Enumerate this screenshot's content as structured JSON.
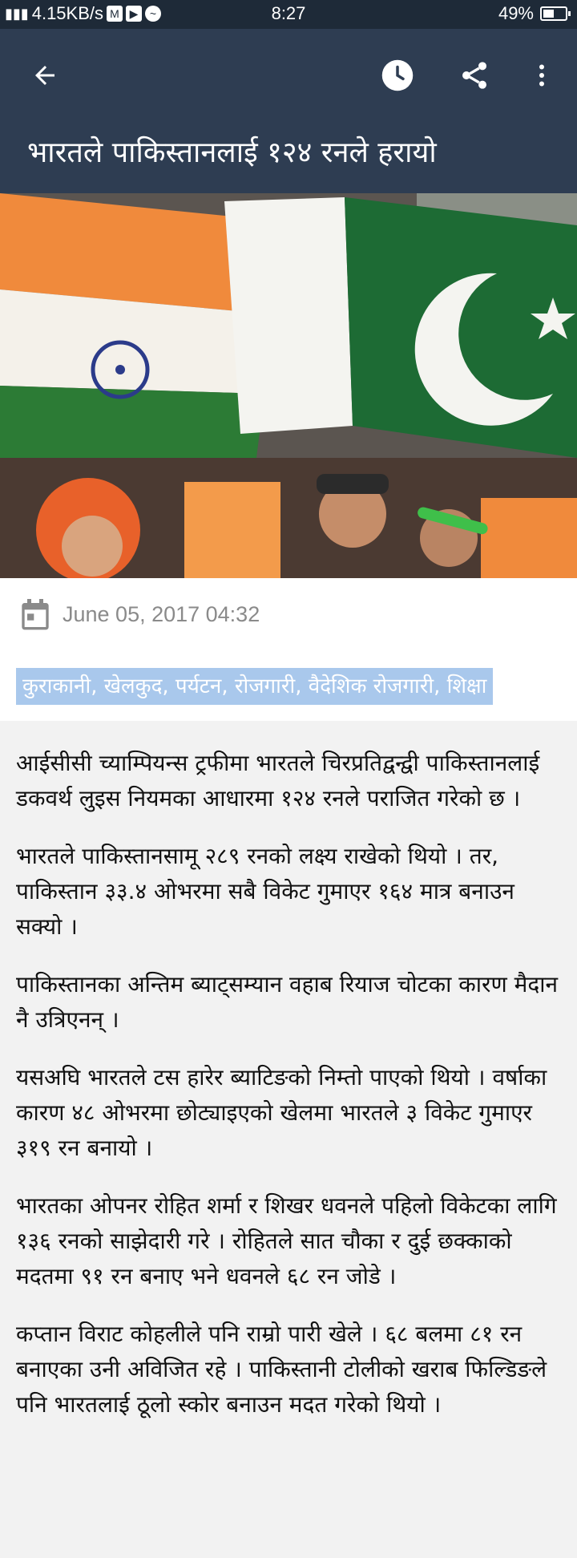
{
  "status_bar": {
    "network_speed": "4.15KB/s",
    "time": "8:27",
    "battery_level": "49%",
    "battery_fraction": 0.49
  },
  "app_bar": {
    "title": "भारतले पाकिस्तानलाई १२४ रनले हरायो"
  },
  "article_meta": {
    "date": "June 05, 2017 04:32",
    "tags": "कुराकानी, खेलकुद, पर्यटन, रोजगारी, वैदेशिक रोजगारी, शिक्षा"
  },
  "article_body": {
    "paragraphs": [
      "आईसीसी च्याम्पियन्स ट्रफीमा भारतले चिरप्रतिद्वन्द्वी पाकिस्तानलाई डकवर्थ लुइस नियमका आधारमा १२४ रनले पराजित गरेको छ ।",
      "भारतले पाकिस्तानसामू २८९ रनको लक्ष्य राखेको थियो । तर, पाकिस्तान ३३.४ ओभरमा सबै विकेट गुमाएर १६४ मात्र बनाउन सक्यो ।",
      "पाकिस्तानका अन्तिम ब्याट्सम्यान वहाब रियाज चोटका कारण मैदान नै उत्रिएनन् ।",
      "यसअघि भारतले टस हारेर ब्याटिङको निम्तो पाएको थियो । वर्षाका कारण ४८ ओभरमा छोट्याइएको खेलमा भारतले ३ विकेट गुमाएर ३१९ रन बनायो ।",
      "भारतका ओपनर रोहित शर्मा र शिखर धवनले पहिलो विकेटका लागि १३६ रनको साझेदारी गरे । रोहितले सात चौका र दुई छक्काको मदतमा ९१ रन बनाए भने धवनले ६८ रन जोडे ।",
      "कप्तान विराट कोहलीले पनि राम्रो पारी खेले । ६८ बलमा ८१ रन बनाएका उनी अविजित रहे । पाकिस्तानी टोलीको खराब फिल्डिङले पनि भारतलाई ठूलो स्कोर बनाउन मदत गरेको थियो ।"
    ]
  },
  "colors": {
    "app_bar": "#2e3d52",
    "status_bar": "#1e2a38",
    "tag_highlight": "#a9c8ec",
    "date_text": "#8a8a8a"
  },
  "icons": {
    "back": "arrow-back-icon",
    "history": "clock-icon",
    "share": "share-icon",
    "more": "more-vert-icon",
    "date": "calendar-icon"
  }
}
